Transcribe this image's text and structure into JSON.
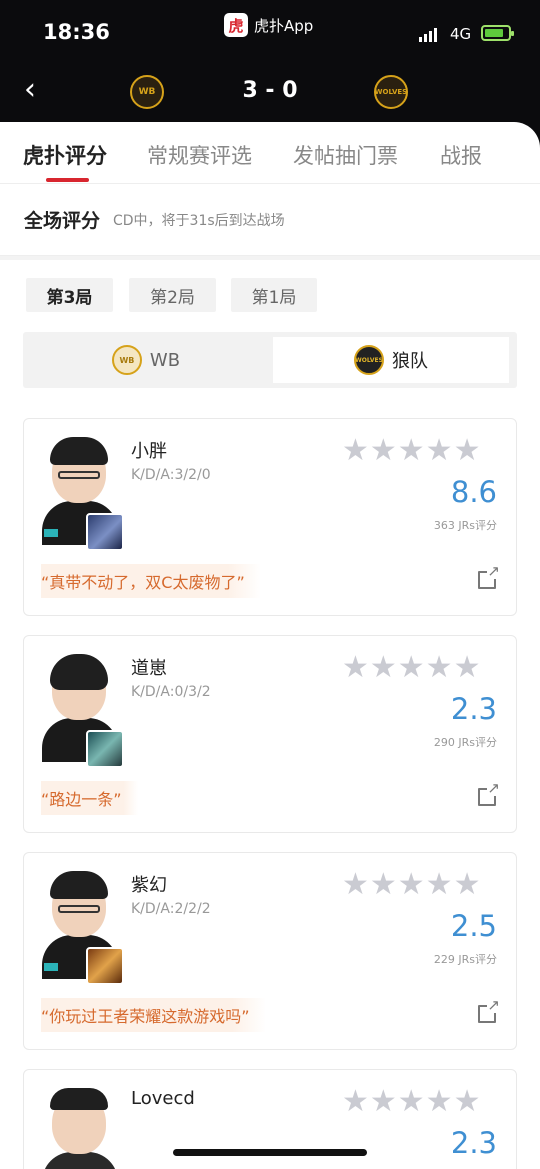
{
  "status_bar": {
    "time": "18:36",
    "app_label": "虎扑App",
    "app_icon_char": "虎",
    "network": "4G"
  },
  "match": {
    "score": "3 - 0",
    "home_logo_text": "WB",
    "away_logo_text": "WOLVES"
  },
  "tabs": [
    "虎扑评分",
    "常规赛评选",
    "发帖抽门票",
    "战报"
  ],
  "overall": {
    "title": "全场评分",
    "subtitle": "CD中，将于31s后到达战场"
  },
  "rounds": [
    "第3局",
    "第2局",
    "第1局"
  ],
  "teams": [
    {
      "name": "WB",
      "logo_text": "WB"
    },
    {
      "name": "狼队",
      "logo_text": "WOLVES"
    }
  ],
  "stars_glyph": "★★★★★",
  "players": [
    {
      "name": "小胖",
      "kda": "K/D/A:3/2/0",
      "score": "8.6",
      "jrs": "363 JRs评分",
      "quote": "“真带不动了，双C太废物了”"
    },
    {
      "name": "道崽",
      "kda": "K/D/A:0/3/2",
      "score": "2.3",
      "jrs": "290 JRs评分",
      "quote": "“路边一条”"
    },
    {
      "name": "紫幻",
      "kda": "K/D/A:2/2/2",
      "score": "2.5",
      "jrs": "229 JRs评分",
      "quote": "“你玩过王者荣耀这款游戏吗”"
    },
    {
      "name": "Lovecd",
      "score": "2.3"
    }
  ],
  "colors": {
    "accent_red": "#d8262f",
    "score_blue": "#3f8fd2",
    "quote_orange": "#d66a2e"
  }
}
